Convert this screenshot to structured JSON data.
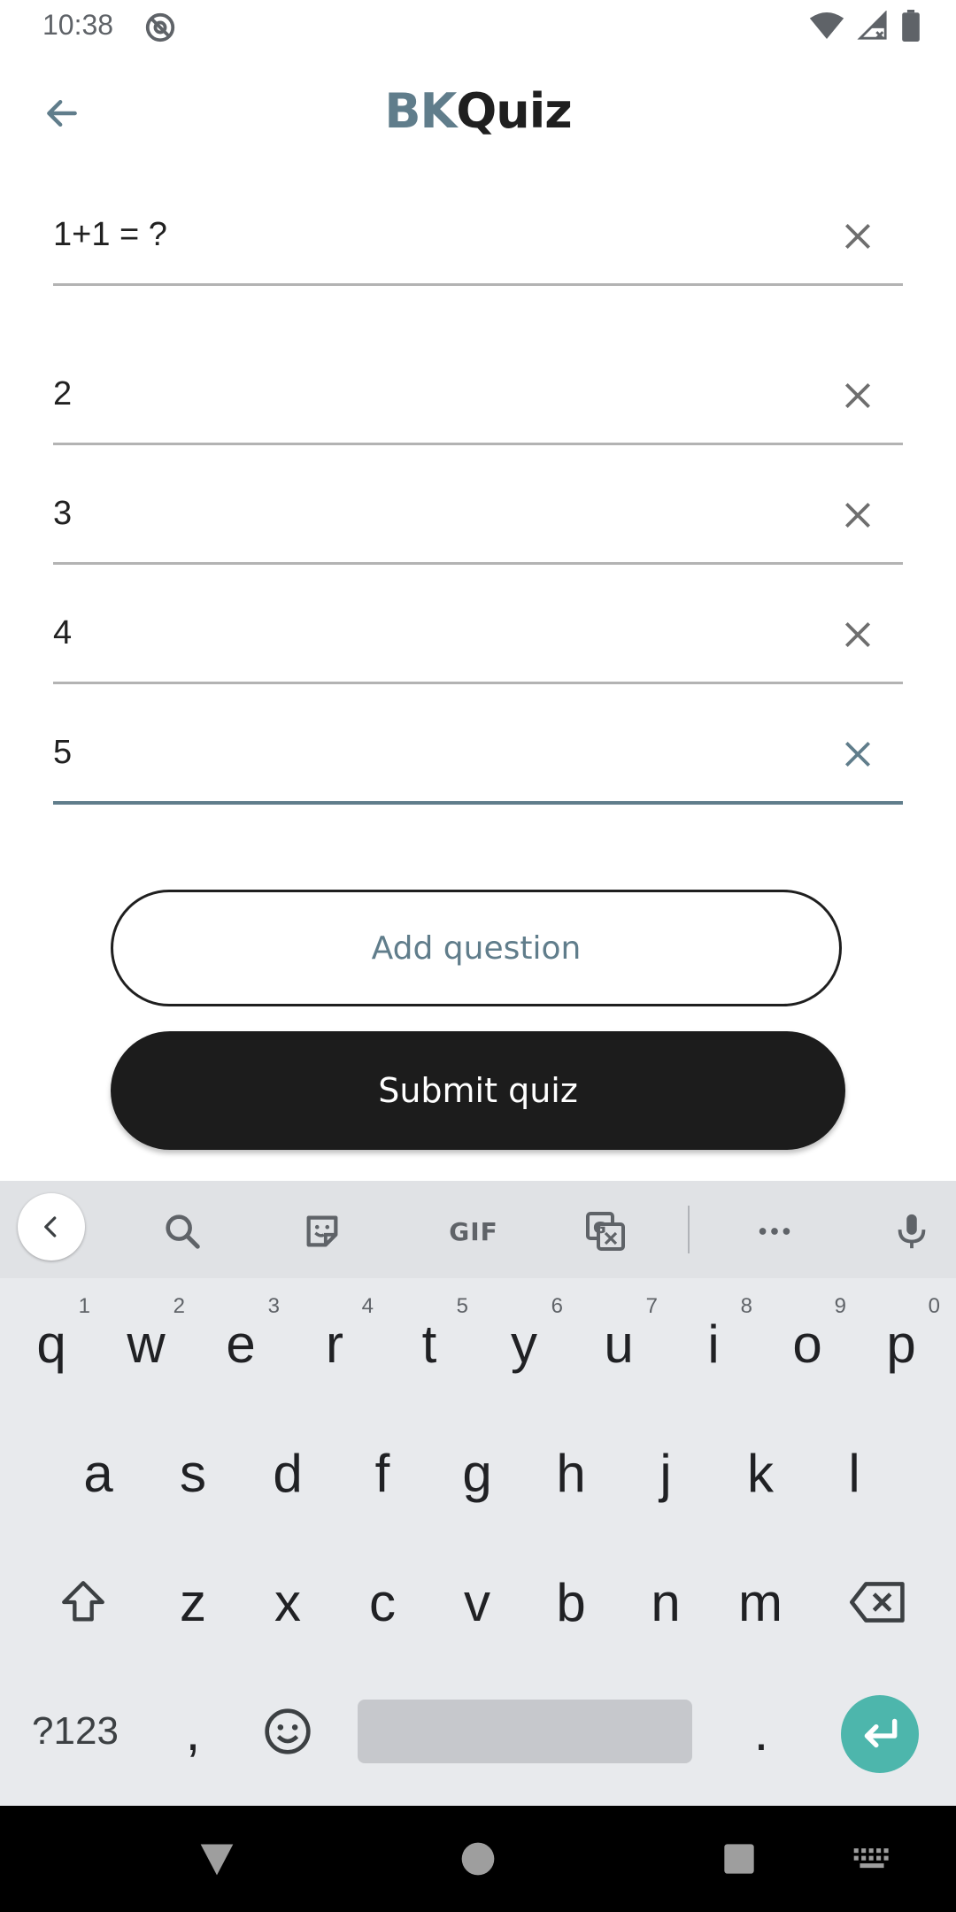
{
  "status_bar": {
    "time": "10:38"
  },
  "app_bar": {
    "title_prefix": "BK",
    "title_suffix": "Quiz"
  },
  "question": {
    "value": "1+1 = ?"
  },
  "answers": [
    {
      "value": "2"
    },
    {
      "value": "3"
    },
    {
      "value": "4"
    },
    {
      "value": "5"
    }
  ],
  "buttons": {
    "add_question": "Add question",
    "submit_quiz": "Submit quiz"
  },
  "keyboard": {
    "toolbar": {
      "gif": "GIF"
    },
    "row1": [
      {
        "k": "q",
        "h": "1"
      },
      {
        "k": "w",
        "h": "2"
      },
      {
        "k": "e",
        "h": "3"
      },
      {
        "k": "r",
        "h": "4"
      },
      {
        "k": "t",
        "h": "5"
      },
      {
        "k": "y",
        "h": "6"
      },
      {
        "k": "u",
        "h": "7"
      },
      {
        "k": "i",
        "h": "8"
      },
      {
        "k": "o",
        "h": "9"
      },
      {
        "k": "p",
        "h": "0"
      }
    ],
    "row2": [
      "a",
      "s",
      "d",
      "f",
      "g",
      "h",
      "j",
      "k",
      "l"
    ],
    "row3": [
      "z",
      "x",
      "c",
      "v",
      "b",
      "n",
      "m"
    ],
    "symbols_label": "?123",
    "comma": ",",
    "period": "."
  },
  "colors": {
    "accent": "#607d8b",
    "enter_key": "#4db6ac",
    "submit_bg": "#1c1c1c"
  }
}
